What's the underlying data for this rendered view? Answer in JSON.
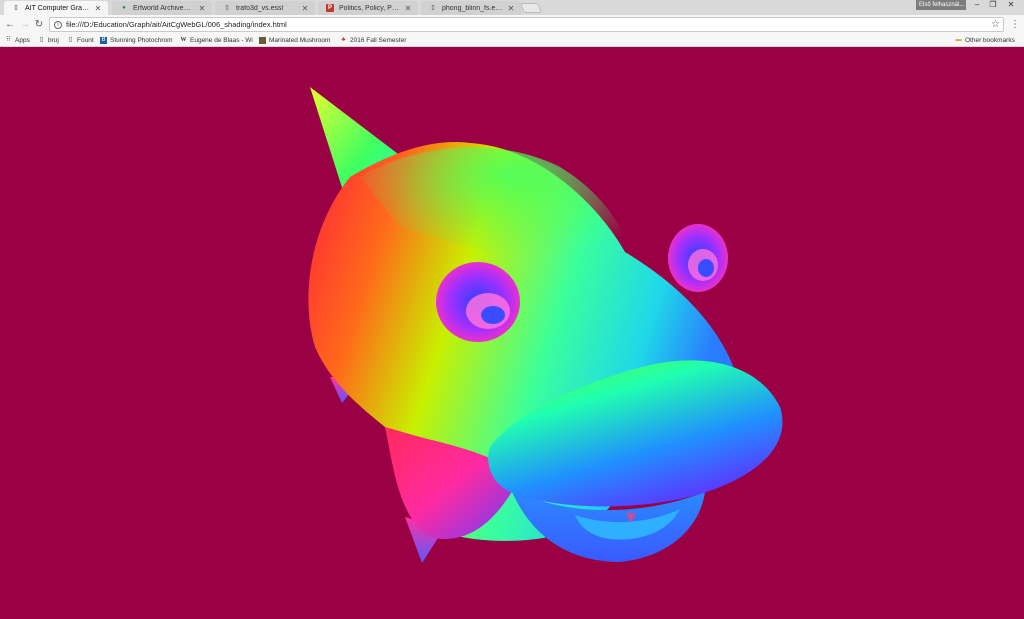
{
  "tabs": [
    {
      "title": "AIT Computer Graphics",
      "favicon": "page-icon",
      "active": true
    },
    {
      "title": "Erfworld Archives - Book",
      "favicon": "globe-icon",
      "active": false
    },
    {
      "title": "trafo3d_vs.essl",
      "favicon": "page-icon",
      "active": false
    },
    {
      "title": "Politics, Policy, Political N",
      "favicon": "p-logo-icon",
      "active": false
    },
    {
      "title": "phong_blinn_fs.essl",
      "favicon": "page-icon",
      "active": false
    }
  ],
  "profile": "Első felhasznál...",
  "address": {
    "url": "file:///D:/Education/Graph/ait/AitCgWebGL/006_shading/index.html"
  },
  "bookmarks": [
    {
      "label": "Apps",
      "icon": "apps-grid-icon"
    },
    {
      "label": "bruj",
      "icon": "page-icon"
    },
    {
      "label": "Fount",
      "icon": "page-icon"
    },
    {
      "label": "Stunning Photochrom",
      "icon": "site-icon"
    },
    {
      "label": "Eugene de Blaas - Wi",
      "icon": "wikipedia-icon"
    },
    {
      "label": "Marinated Mushroom",
      "icon": "site-image-icon"
    },
    {
      "label": "2016 Fall Semester",
      "icon": "bookmark-site-icon"
    }
  ],
  "other_bookmarks": "Other bookmarks",
  "colors": {
    "canvas_background": "#9a0044",
    "chrome": "#f6f6f6"
  }
}
